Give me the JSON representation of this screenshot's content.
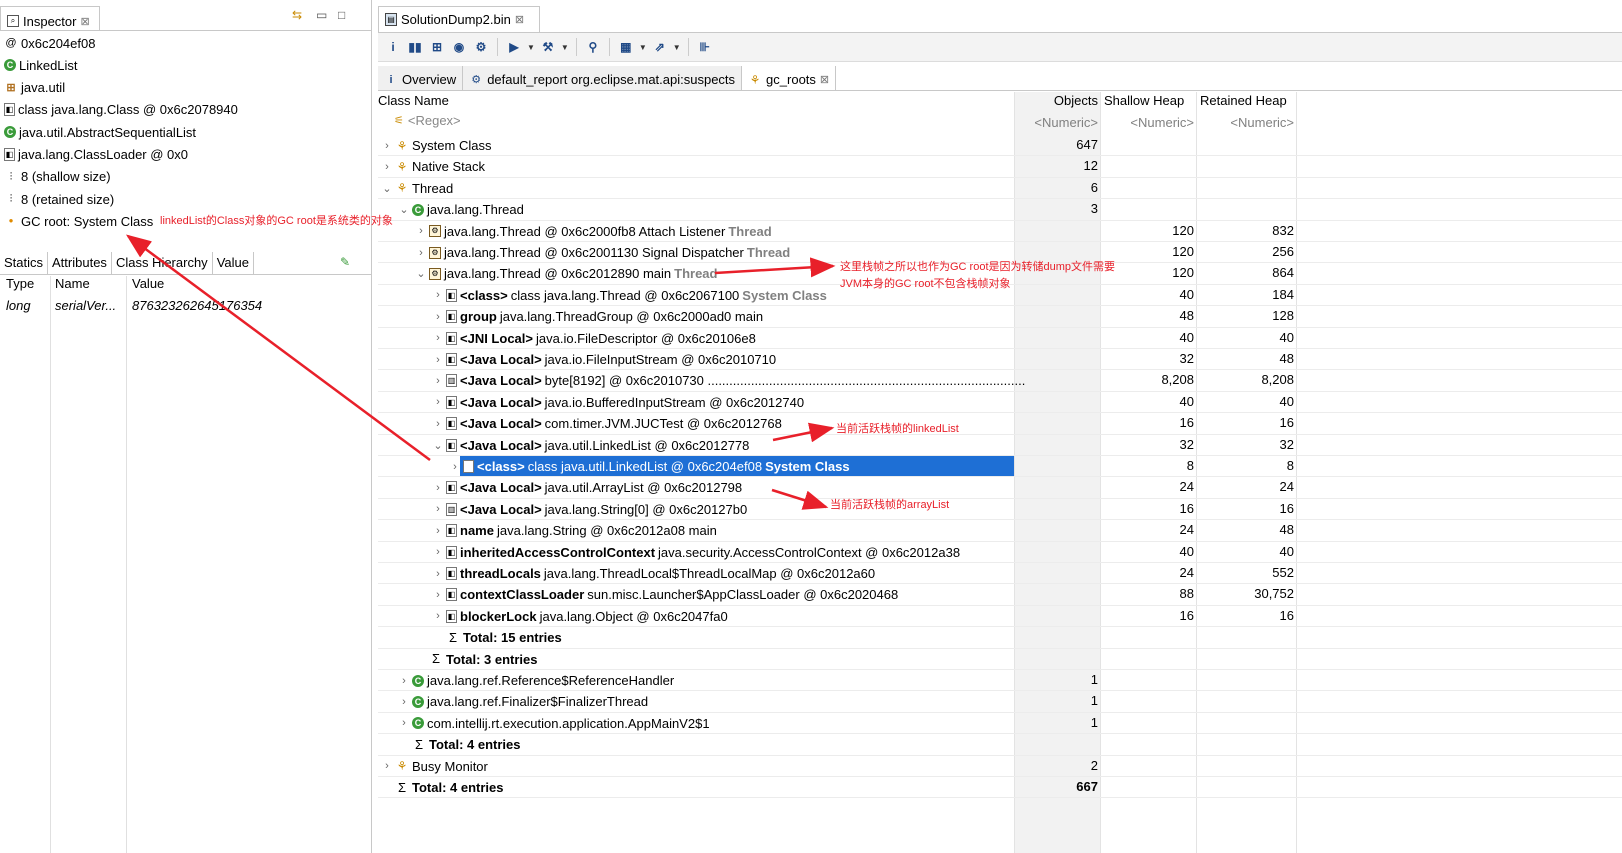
{
  "inspector": {
    "tab_label": "Inspector",
    "items": [
      {
        "icon": "at-icon",
        "label": "0x6c204ef08"
      },
      {
        "icon": "class-icon",
        "label": "LinkedList"
      },
      {
        "icon": "package-icon",
        "label": "java.util"
      },
      {
        "icon": "object-icon",
        "label": "class java.lang.Class @ 0x6c2078940"
      },
      {
        "icon": "class-icon",
        "label": "java.util.AbstractSequentialList"
      },
      {
        "icon": "object-icon",
        "label": "java.lang.ClassLoader @ 0x0"
      },
      {
        "icon": "size-icon",
        "label": "8 (shallow size)"
      },
      {
        "icon": "size-icon",
        "label": "8 (retained size)"
      },
      {
        "icon": "gc-root-icon",
        "label": "GC root: System Class"
      }
    ],
    "tabs": [
      "Statics",
      "Attributes",
      "Class Hierarchy",
      "Value"
    ],
    "columns": [
      "Type",
      "Name",
      "Value"
    ],
    "rows": [
      {
        "type": "long",
        "name": "serialVer...",
        "value": "876323262645176354"
      }
    ]
  },
  "editor": {
    "tab_label": "SolutionDump2.bin",
    "query_tabs": [
      "Overview",
      "default_report  org.eclipse.mat.api:suspects",
      "gc_roots"
    ],
    "columns": {
      "name": "Class Name",
      "objects": "Objects",
      "shallow": "Shallow Heap",
      "retained": "Retained Heap"
    },
    "filters": {
      "regex": "<Regex>",
      "numeric": "<Numeric>"
    },
    "rows": [
      {
        "indent": 0,
        "twisty": ">",
        "icon": "group",
        "name": "System Class",
        "objects": "647"
      },
      {
        "indent": 0,
        "twisty": ">",
        "icon": "group",
        "name": "Native Stack",
        "objects": "12"
      },
      {
        "indent": 0,
        "twisty": "v",
        "icon": "group",
        "name": "Thread",
        "objects": "6"
      },
      {
        "indent": 1,
        "twisty": "v",
        "icon": "class",
        "name": "java.lang.Thread",
        "objects": "3"
      },
      {
        "indent": 2,
        "twisty": ">",
        "icon": "thread",
        "name": "java.lang.Thread @ 0x6c2000fb8  Attach Listener",
        "suffix": "Thread",
        "shallow": "120",
        "retained": "832"
      },
      {
        "indent": 2,
        "twisty": ">",
        "icon": "thread",
        "name": "java.lang.Thread @ 0x6c2001130  Signal Dispatcher",
        "suffix": "Thread",
        "shallow": "120",
        "retained": "256"
      },
      {
        "indent": 2,
        "twisty": "v",
        "icon": "thread",
        "name": "java.lang.Thread @ 0x6c2012890  main",
        "suffix": "Thread",
        "shallow": "120",
        "retained": "864"
      },
      {
        "indent": 3,
        "twisty": ">",
        "icon": "object",
        "bold": "<class>",
        "name": "class java.lang.Thread @ 0x6c2067100",
        "suffix": "System Class",
        "shallow": "40",
        "retained": "184"
      },
      {
        "indent": 3,
        "twisty": ">",
        "icon": "object",
        "bold": "group",
        "name": "java.lang.ThreadGroup @ 0x6c2000ad0  main",
        "shallow": "48",
        "retained": "128"
      },
      {
        "indent": 3,
        "twisty": ">",
        "icon": "object",
        "bold": "<JNI Local>",
        "name": "java.io.FileDescriptor @ 0x6c20106e8",
        "shallow": "40",
        "retained": "40"
      },
      {
        "indent": 3,
        "twisty": ">",
        "icon": "object",
        "bold": "<Java Local>",
        "name": "java.io.FileInputStream @ 0x6c2010710",
        "shallow": "32",
        "retained": "48"
      },
      {
        "indent": 3,
        "twisty": ">",
        "icon": "array",
        "bold": "<Java Local>",
        "name": "byte[8192] @ 0x6c2010730  ........................................................................................",
        "shallow": "8,208",
        "retained": "8,208"
      },
      {
        "indent": 3,
        "twisty": ">",
        "icon": "object",
        "bold": "<Java Local>",
        "name": "java.io.BufferedInputStream @ 0x6c2012740",
        "shallow": "40",
        "retained": "40"
      },
      {
        "indent": 3,
        "twisty": ">",
        "icon": "object",
        "bold": "<Java Local>",
        "name": "com.timer.JVM.JUCTest @ 0x6c2012768",
        "shallow": "16",
        "retained": "16"
      },
      {
        "indent": 3,
        "twisty": "v",
        "icon": "object",
        "bold": "<Java Local>",
        "name": "java.util.LinkedList @ 0x6c2012778",
        "shallow": "32",
        "retained": "32"
      },
      {
        "indent": 4,
        "twisty": ">",
        "icon": "object",
        "bold": "<class>",
        "name": "class java.util.LinkedList @ 0x6c204ef08",
        "suffix": "System Class",
        "shallow": "8",
        "retained": "8",
        "selected": true
      },
      {
        "indent": 3,
        "twisty": ">",
        "icon": "object",
        "bold": "<Java Local>",
        "name": "java.util.ArrayList @ 0x6c2012798",
        "shallow": "24",
        "retained": "24"
      },
      {
        "indent": 3,
        "twisty": ">",
        "icon": "array",
        "bold": "<Java Local>",
        "name": "java.lang.String[0] @ 0x6c20127b0",
        "shallow": "16",
        "retained": "16"
      },
      {
        "indent": 3,
        "twisty": ">",
        "icon": "object",
        "bold": "name",
        "name": "java.lang.String @ 0x6c2012a08  main",
        "shallow": "24",
        "retained": "48"
      },
      {
        "indent": 3,
        "twisty": ">",
        "icon": "object",
        "bold": "inheritedAccessControlContext",
        "name": "java.security.AccessControlContext @ 0x6c2012a38",
        "shallow": "40",
        "retained": "40"
      },
      {
        "indent": 3,
        "twisty": ">",
        "icon": "object",
        "bold": "threadLocals",
        "name": "java.lang.ThreadLocal$ThreadLocalMap @ 0x6c2012a60",
        "shallow": "24",
        "retained": "552"
      },
      {
        "indent": 3,
        "twisty": ">",
        "icon": "object",
        "bold": "contextClassLoader",
        "name": "sun.misc.Launcher$AppClassLoader @ 0x6c2020468",
        "shallow": "88",
        "retained": "30,752"
      },
      {
        "indent": 3,
        "twisty": ">",
        "icon": "object",
        "bold": "blockerLock",
        "name": "java.lang.Object @ 0x6c2047fa0",
        "shallow": "16",
        "retained": "16"
      },
      {
        "indent": 3,
        "twisty": "",
        "icon": "sigma",
        "bold": "Total: 15 entries",
        "name": ""
      },
      {
        "indent": 2,
        "twisty": "",
        "icon": "sigma",
        "bold": "Total: 3 entries",
        "name": ""
      },
      {
        "indent": 1,
        "twisty": ">",
        "icon": "class",
        "name": "java.lang.ref.Reference$ReferenceHandler",
        "objects": "1"
      },
      {
        "indent": 1,
        "twisty": ">",
        "icon": "class",
        "name": "java.lang.ref.Finalizer$FinalizerThread",
        "objects": "1"
      },
      {
        "indent": 1,
        "twisty": ">",
        "icon": "class",
        "name": "com.intellij.rt.execution.application.AppMainV2$1",
        "objects": "1"
      },
      {
        "indent": 1,
        "twisty": "",
        "icon": "sigma",
        "bold": "Total: 4 entries",
        "name": ""
      },
      {
        "indent": 0,
        "twisty": ">",
        "icon": "group",
        "name": "Busy Monitor",
        "objects": "2"
      },
      {
        "indent": 0,
        "twisty": "",
        "icon": "sigma",
        "bold": "Total: 4 entries",
        "name": "",
        "objects": "667",
        "objects_bold": true
      }
    ]
  },
  "annotations": {
    "gc_root": "linkedList的Class对象的GC root是系统类的对象",
    "main_thread_line1": "这里栈帧之所以也作为GC root是因为转储dump文件需要",
    "main_thread_line2": "JVM本身的GC root不包含栈帧对象",
    "linked_list": "当前活跃栈帧的linkedList",
    "array_list": "当前活跃栈帧的arrayList"
  },
  "colors": {
    "selection": "#1e6fd5",
    "annotation": "#e8202a",
    "class_icon": "#3a9b3a"
  }
}
